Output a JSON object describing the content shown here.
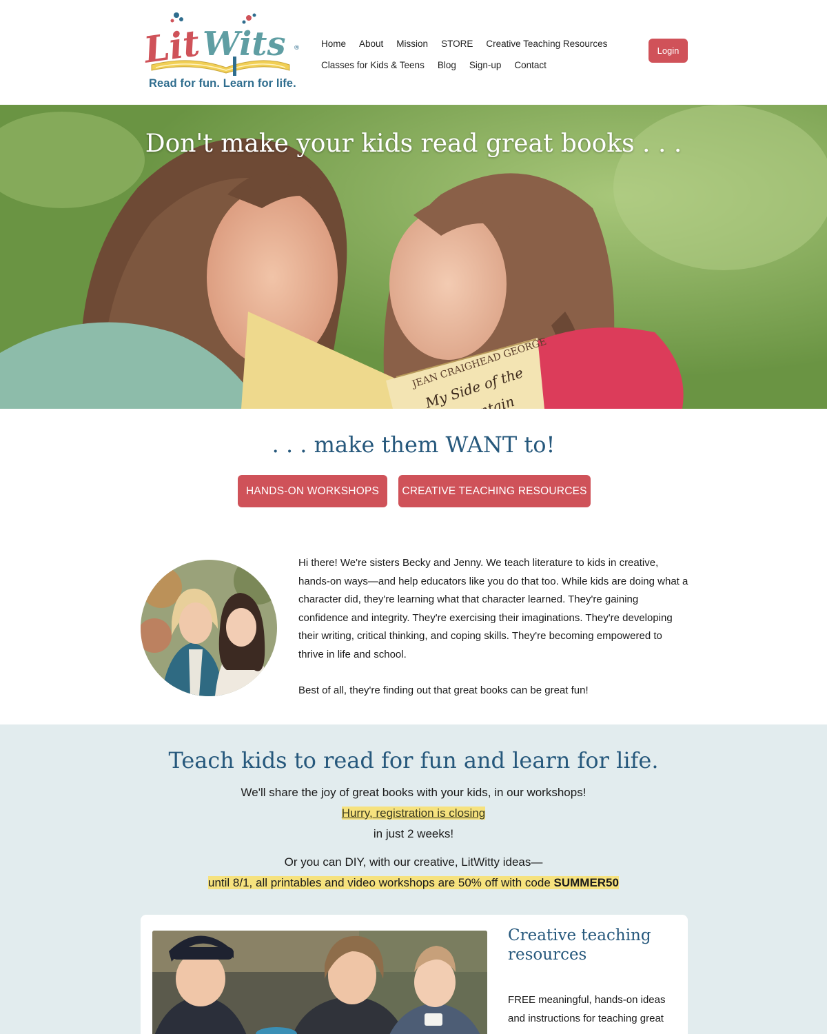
{
  "header": {
    "logo": {
      "brand": "LitWits",
      "tagline": "Read for fun. Learn for life."
    },
    "nav": {
      "row1": [
        "Home",
        "About",
        "Mission",
        "STORE",
        "Creative Teaching Resources"
      ],
      "row2": [
        "Classes for Kids & Teens",
        "Blog",
        "Sign-up",
        "Contact"
      ]
    },
    "login_label": "Login"
  },
  "hero": {
    "title": "Don't make your kids read great books . . .",
    "book_cover_text": [
      "JEAN CRAIGHEAD GEORGE",
      "My Side of the",
      "Mountain"
    ]
  },
  "tagline": ". . . make them WANT to!",
  "cta": {
    "workshops": "HANDS-ON WORKSHOPS",
    "resources": "CREATIVE TEACHING RESOURCES"
  },
  "intro": {
    "paragraph1": "Hi there!  We're sisters Becky and Jenny. We teach literature to kids in creative, hands-on ways—and help educators like you do that too. While  kids are doing what a character did, they're learning what that character learned. They're gaining confidence and integrity. They're exercising their imaginations. They're developing their writing, critical thinking, and coping skills. They're becoming empowered to thrive in life and school.",
    "paragraph2": "Best of all, they're finding out that great books can be great fun!"
  },
  "teach": {
    "title": "Teach kids to read for fun and learn for life.",
    "line1": "We'll share the joy of great books with your kids, in our workshops!",
    "link": "Hurry, registration is closing",
    "line2": "in just 2 weeks!",
    "line3": "Or you can DIY, with our creative, LitWitty ideas—",
    "promo_text": "until 8/1, all printables and video workshops are 50% off with code ",
    "promo_code": "SUMMER50"
  },
  "card": {
    "title": "Creative teaching resources",
    "text": "FREE meaningful, hands-on ideas and instructions for teaching great"
  },
  "colors": {
    "brand_red": "#cf5259",
    "brand_blue": "#26587c",
    "section_teal": "#e2ecee",
    "highlight": "#f6e27e"
  }
}
